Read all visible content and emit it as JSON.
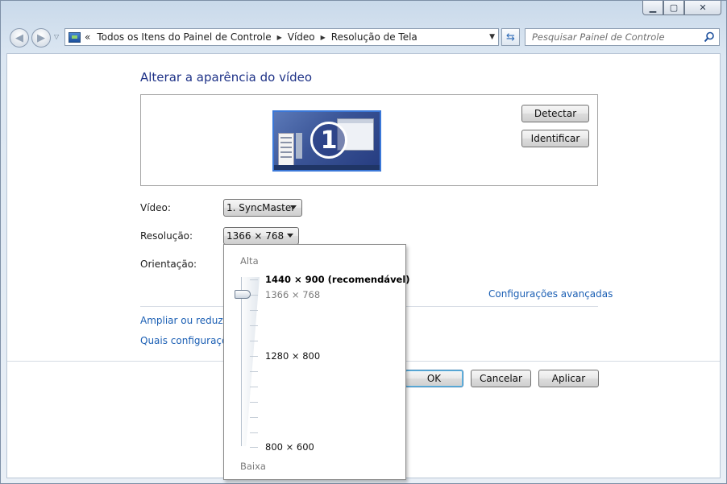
{
  "window": {
    "minimize": "▁",
    "maximize": "▢",
    "close": "✕"
  },
  "nav": {
    "back": "◀",
    "forward": "▶",
    "breadcrumb_prefix": "«",
    "breadcrumbs": [
      "Todos os Itens do Painel de Controle",
      "Vídeo",
      "Resolução de Tela"
    ],
    "search_placeholder": "Pesquisar Painel de Controle"
  },
  "page": {
    "title": "Alterar a aparência do vídeo",
    "monitor_number": "1",
    "detect_label": "Detectar",
    "identify_label": "Identificar",
    "video_label": "Vídeo:",
    "video_value": "1. SyncMaster",
    "resolution_label": "Resolução:",
    "resolution_value": "1366 × 768",
    "orientation_label": "Orientação:",
    "advanced_link": "Configurações avançadas",
    "link_enlarge": "Ampliar ou reduzir t",
    "link_which": "Quais configuraçõe",
    "ok_label": "OK",
    "cancel_label": "Cancelar",
    "apply_label": "Aplicar"
  },
  "resolution_popup": {
    "high_label": "Alta",
    "low_label": "Baixa",
    "options": [
      {
        "label": "1440 × 900 (recomendável)",
        "recommended": true
      },
      {
        "label": "1366 × 768",
        "current": true
      },
      {
        "label": "1280 × 800"
      },
      {
        "label": "800 × 600"
      }
    ]
  },
  "colors": {
    "title": "#1e3287",
    "link": "#1b5fb4",
    "monitor_border": "#3b78d8"
  }
}
